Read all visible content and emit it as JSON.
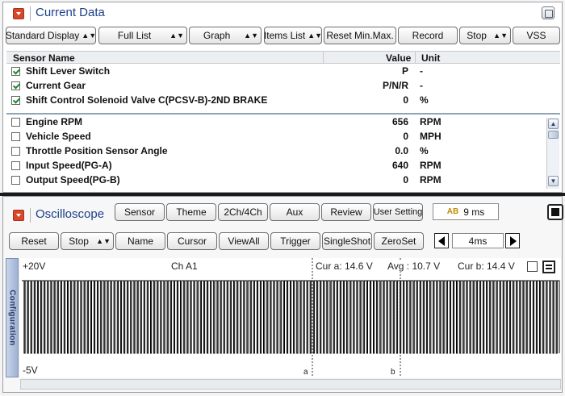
{
  "current_data": {
    "title": "Current Data",
    "toolbar": {
      "display_mode": "Standard Display",
      "full_list": "Full List",
      "graph": "Graph",
      "items_list": "Items List",
      "reset_minmax": "Reset Min.Max.",
      "record": "Record",
      "stop": "Stop",
      "vss": "VSS"
    },
    "columns": {
      "name": "Sensor Name",
      "value": "Value",
      "unit": "Unit"
    },
    "rows": [
      {
        "name": "Shift Lever Switch",
        "value": "P",
        "unit": "-",
        "checked": true
      },
      {
        "name": "Current Gear",
        "value": "P/N/R",
        "unit": "-",
        "checked": true
      },
      {
        "name": "Shift Control Solenoid Valve C(PCSV-B)-2ND BRAKE",
        "value": "0",
        "unit": "%",
        "checked": true
      },
      {
        "name": "Engine RPM",
        "value": "656",
        "unit": "RPM",
        "checked": false
      },
      {
        "name": "Vehicle Speed",
        "value": "0",
        "unit": "MPH",
        "checked": false
      },
      {
        "name": "Throttle Position Sensor Angle",
        "value": "0.0",
        "unit": "%",
        "checked": false
      },
      {
        "name": "Input Speed(PG-A)",
        "value": "640",
        "unit": "RPM",
        "checked": false
      },
      {
        "name": "Output Speed(PG-B)",
        "value": "0",
        "unit": "RPM",
        "checked": false
      }
    ]
  },
  "oscilloscope": {
    "title": "Oscilloscope",
    "toolbar_top": {
      "sensor": "Sensor",
      "theme": "Theme",
      "channels": "2Ch/4Ch",
      "aux": "Aux",
      "review": "Review",
      "user_setting": "User Setting"
    },
    "time_per_div": {
      "icon_text": "AB",
      "value": "9 ms"
    },
    "toolbar_bottom": {
      "reset": "Reset",
      "stop": "Stop",
      "name": "Name",
      "cursor": "Cursor",
      "view_all": "ViewAll",
      "trigger": "Trigger",
      "single_shot": "SingleShot",
      "zero_set": "ZeroSet",
      "timebase": "4ms"
    },
    "config_tab": "Configuration",
    "scope": {
      "top_voltage": "+20V",
      "bottom_voltage": "-5V",
      "channel": "Ch A1",
      "cur_a": "Cur a: 14.6 V",
      "avg": "Avg : 10.7 V",
      "cur_b": "Cur b: 14.4 V",
      "cursor_a_label": "a",
      "cursor_b_label": "b"
    }
  },
  "colors": {
    "title_blue": "#1c3f8a",
    "collapse_red": "#d9472b",
    "checkmark_green": "#1f8a2a",
    "waveform": "#000000"
  }
}
